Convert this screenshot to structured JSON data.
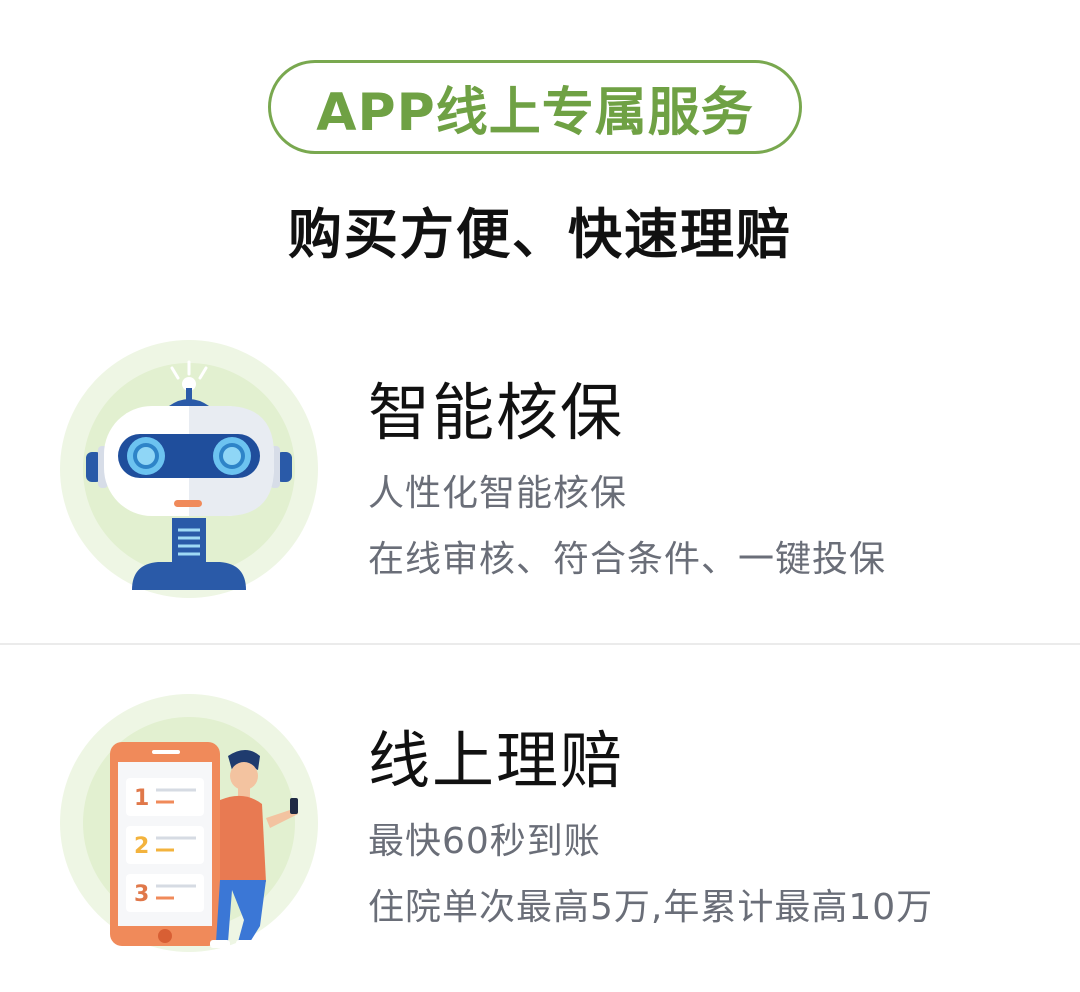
{
  "header": {
    "badge": "APP线上专属服务",
    "subtitle": "购买方便、快速理赔"
  },
  "features": [
    {
      "icon": "robot-icon",
      "title": "智能核保",
      "lines": [
        "人性化智能核保",
        "在线审核、符合条件、一键投保"
      ]
    },
    {
      "icon": "online-claim-icon",
      "title": "线上理赔",
      "lines": [
        "最快60秒到账",
        "住院单次最高5万,年累计最高10万"
      ],
      "phone_list_numbers": [
        "1",
        "2",
        "3"
      ]
    }
  ],
  "colors": {
    "accent_green": "#6fa144",
    "circle_bg": "#eaf4dc",
    "robot_blue": "#2a5aa8",
    "phone_orange": "#f08a5a"
  }
}
